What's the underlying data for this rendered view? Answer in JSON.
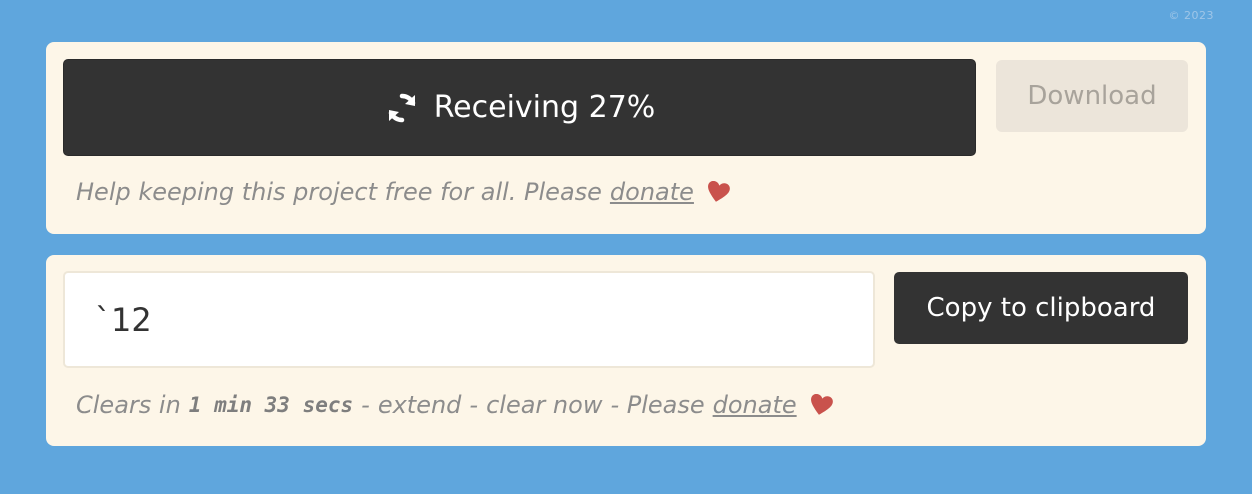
{
  "corner_text": "© 2023",
  "receive": {
    "label": "Receiving 27%",
    "icon": "sync-icon",
    "progress_percent": 27
  },
  "download": {
    "label": "Download"
  },
  "help": {
    "text": "Help keeping this project free for all. Please",
    "donate_label": "donate",
    "icon": "heart-icon"
  },
  "clipboard": {
    "value": "`12",
    "copy_label": "Copy to clipboard"
  },
  "clear": {
    "prefix": "Clears in",
    "time": "1 min 33 secs",
    "sep1": "-",
    "extend_label": "extend",
    "sep2": "-",
    "clear_now_label": "clear now",
    "sep3": "- Please",
    "donate_label": "donate"
  },
  "colors": {
    "background": "#5fa6dd",
    "card": "#fdf6e8",
    "button_dark": "#333333",
    "heart": "#c9524c"
  }
}
